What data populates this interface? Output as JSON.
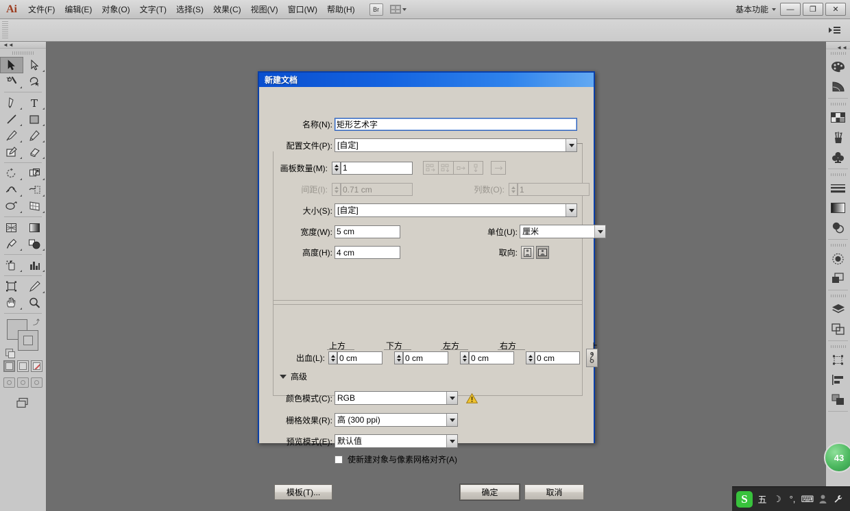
{
  "app": {
    "logo": "Ai",
    "workspace_label": "基本功能",
    "menus": [
      {
        "label": "文件(F)",
        "name": "menu-file"
      },
      {
        "label": "编辑(E)",
        "name": "menu-edit"
      },
      {
        "label": "对象(O)",
        "name": "menu-object"
      },
      {
        "label": "文字(T)",
        "name": "menu-type"
      },
      {
        "label": "选择(S)",
        "name": "menu-select"
      },
      {
        "label": "效果(C)",
        "name": "menu-effect"
      },
      {
        "label": "视图(V)",
        "name": "menu-view"
      },
      {
        "label": "窗口(W)",
        "name": "menu-window"
      },
      {
        "label": "帮助(H)",
        "name": "menu-help"
      }
    ],
    "bridge_label": "Br",
    "window_controls": {
      "minimize": "—",
      "restore": "❐",
      "close": "✕"
    }
  },
  "dialog": {
    "title": "新建文档",
    "name_label": "名称(N):",
    "name_value": "矩形艺术字",
    "profile_label": "配置文件(P):",
    "profile_value": "[自定]",
    "artboards_label": "画板数量(M):",
    "artboards_value": "1",
    "spacing_label": "间距(I):",
    "spacing_value": "0.71 cm",
    "columns_label": "列数(O):",
    "columns_value": "1",
    "size_label": "大小(S):",
    "size_value": "[自定]",
    "width_label": "宽度(W):",
    "width_value": "5 cm",
    "height_label": "高度(H):",
    "height_value": "4 cm",
    "units_label": "单位(U):",
    "units_value": "厘米",
    "orientation_label": "取向:",
    "bleed_label": "出血(L):",
    "bleed_top_label": "上方",
    "bleed_bottom_label": "下方",
    "bleed_left_label": "左方",
    "bleed_right_label": "右方",
    "bleed_top_value": "0 cm",
    "bleed_bottom_value": "0 cm",
    "bleed_left_value": "0 cm",
    "bleed_right_value": "0 cm",
    "advanced_label": "高级",
    "color_mode_label": "颜色模式(C):",
    "color_mode_value": "RGB",
    "raster_label": "栅格效果(R):",
    "raster_value": "高 (300 ppi)",
    "preview_label": "预览模式(E):",
    "preview_value": "默认值",
    "align_pixel_label": "使新建对象与像素网格对齐(A)",
    "template_button": "模板(T)...",
    "ok_button": "确定",
    "cancel_button": "取消"
  },
  "status": {
    "badge_value": "43"
  },
  "ime": {
    "mode": "五",
    "moon": "☽",
    "punct": "°,",
    "keyboard": "⌨",
    "user": "👤",
    "wrench": "🔧"
  },
  "colors": {
    "title_blue": "#0a4fcf",
    "dialog_face": "#d4d0c8",
    "canvas": "#6e6e6e",
    "panel": "#c8c8c8",
    "accent_warning": "#f0c330",
    "ime_green": "#38c23c"
  }
}
